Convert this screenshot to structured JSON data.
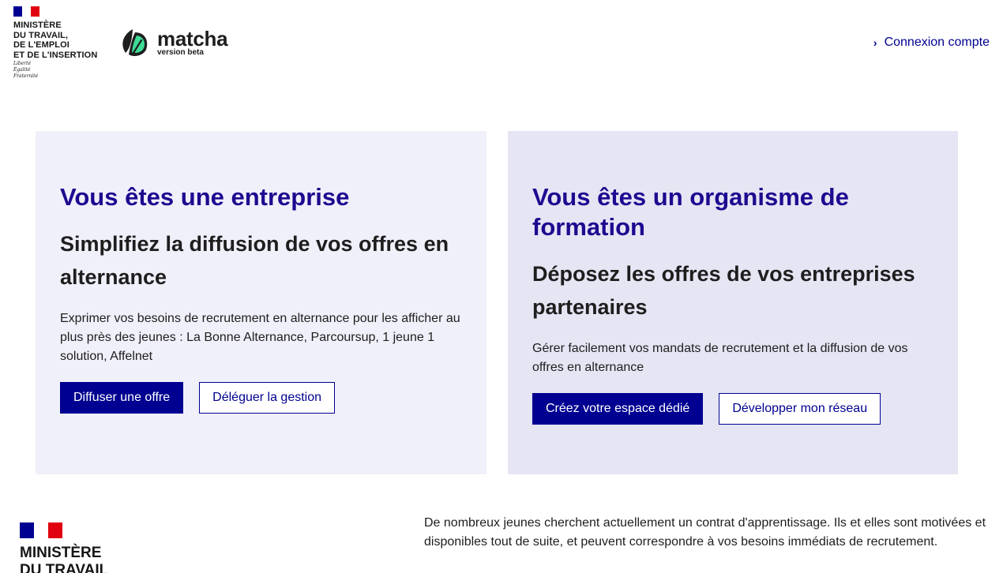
{
  "header": {
    "gov_name": "MINISTÈRE\nDU TRAVAIL,\nDE L'EMPLOI\nET DE L'INSERTION",
    "gov_motto": "Liberté\nÉgalité\nFraternité",
    "brand_name": "matcha",
    "brand_tag": "version beta",
    "login_label": "Connexion compte"
  },
  "cards": [
    {
      "title": "Vous êtes une entreprise",
      "subtitle": "Simplifiez la diffusion de vos offres en alternance",
      "text": "Exprimer vos besoins de recrutement en alternance pour les afficher au plus près des jeunes : La Bonne Alternance, Parcoursup, 1 jeune 1 solution, Affelnet",
      "primary_label": "Diffuser une offre",
      "secondary_label": "Déléguer la gestion"
    },
    {
      "title": "Vous êtes un organisme de formation",
      "subtitle": "Déposez les offres de vos entreprises partenaires",
      "text": "Gérer facilement vos mandats de recrutement et la diffusion de vos offres en alternance",
      "primary_label": "Créez votre espace dédié",
      "secondary_label": "Développer mon réseau"
    }
  ],
  "footer": {
    "gov_name": "MINISTÈRE\nDU TRAVAIL",
    "intro": "De nombreux jeunes cherchent actuellement un contrat d'apprentissage. Ils et elles sont motivées et disponibles tout de suite, et peuvent correspondre à vos besoins immédiats de recrutement."
  },
  "colors": {
    "primary": "#000091",
    "title_blue": "#1c0a90",
    "card_left_bg": "#f0f0fa",
    "card_right_bg": "#e5e5f4",
    "brand_green": "#3ddc97"
  },
  "icons": {
    "login_chevron": "chevron-right-icon",
    "brand_logo": "leaf-logo-icon"
  }
}
